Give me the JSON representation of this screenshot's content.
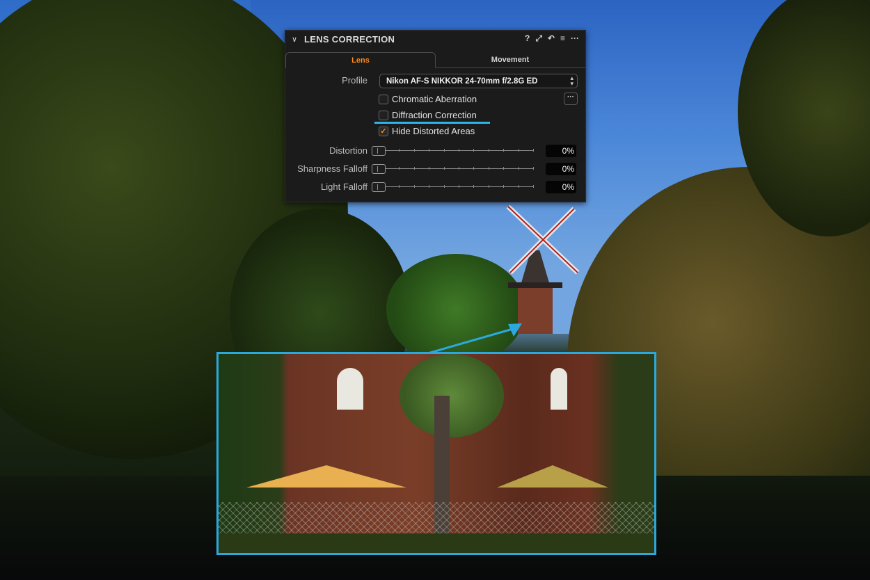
{
  "panel": {
    "title": "LENS CORRECTION",
    "tools": [
      {
        "icon": "help-icon",
        "glyph": "?"
      },
      {
        "icon": "expand-icon",
        "glyph": "⤢"
      },
      {
        "icon": "reset-icon",
        "glyph": "↶"
      },
      {
        "icon": "menu-icon",
        "glyph": "≡"
      },
      {
        "icon": "more-icon",
        "glyph": "···"
      }
    ],
    "tabs": [
      {
        "label": "Lens",
        "active": true
      },
      {
        "label": "Movement",
        "active": false
      }
    ],
    "profile_label": "Profile",
    "profile_value": "Nikon AF-S NIKKOR 24-70mm f/2.8G ED",
    "checkboxes": [
      {
        "label": "Chromatic Aberration",
        "checked": false
      },
      {
        "label": "Diffraction Correction",
        "checked": false,
        "highlighted": true
      },
      {
        "label": "Hide Distorted Areas",
        "checked": true
      }
    ],
    "more_button": "···",
    "sliders": [
      {
        "label": "Distortion",
        "value": "0%",
        "position": 0
      },
      {
        "label": "Sharpness Falloff",
        "value": "0%",
        "position": 0
      },
      {
        "label": "Light Falloff",
        "value": "0%",
        "position": 0
      }
    ]
  },
  "colors": {
    "accent_orange": "#ff8a1a",
    "highlight_blue": "#2bb5e8",
    "panel_bg": "#1b1b1c"
  }
}
